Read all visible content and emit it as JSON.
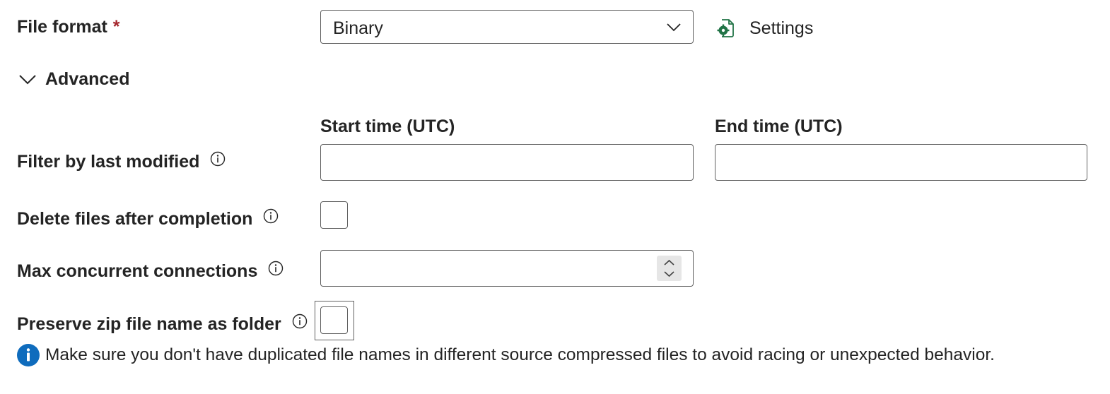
{
  "file_format": {
    "label": "File format",
    "required_mark": "*",
    "selected": "Binary",
    "settings_label": "Settings"
  },
  "advanced": {
    "label": "Advanced",
    "expanded": true
  },
  "filter_last_modified": {
    "label": "Filter by last modified",
    "start_header": "Start time (UTC)",
    "end_header": "End time (UTC)",
    "start_value": "",
    "end_value": ""
  },
  "delete_files": {
    "label": "Delete files after completion",
    "checked": false
  },
  "max_connections": {
    "label": "Max concurrent connections",
    "value": ""
  },
  "preserve_zip": {
    "label": "Preserve zip file name as folder",
    "checked": false
  },
  "info_message": {
    "text": "Make sure you don't have duplicated file names in different source compressed files to avoid racing or unexpected behavior."
  },
  "colors": {
    "required": "#a4262c",
    "info_blue": "#0f6cbd",
    "settings_icon": "#217346",
    "border": "#616161"
  }
}
